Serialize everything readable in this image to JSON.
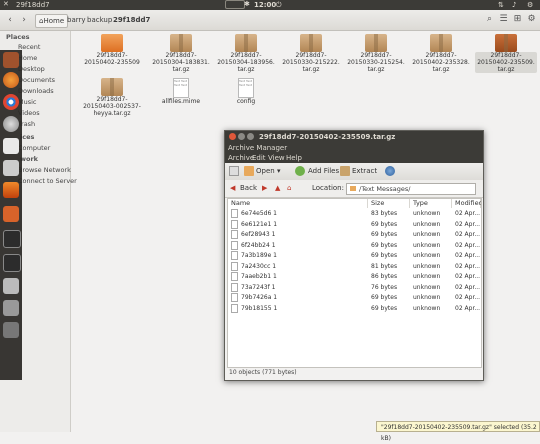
{
  "top_panel": {
    "title": "29f18dd7",
    "clock": "12:00"
  },
  "toolbar": {
    "breadcrumbs": [
      "Home",
      "barry",
      "backup",
      "29f18dd7"
    ]
  },
  "sidebar": {
    "places_header": "Places",
    "places": [
      "Recent",
      "Home",
      "Desktop",
      "Documents",
      "Downloads",
      "Music",
      "Videos",
      "Trash"
    ],
    "devices_header": "ices",
    "devices": [
      "Computer"
    ],
    "network_header": "work",
    "network": [
      "Browse Network",
      "Connect to Server"
    ]
  },
  "files": [
    {
      "label": [
        "29f18dd7-",
        "20150402-235509"
      ],
      "type": "folder"
    },
    {
      "label": [
        "29f18dd7-",
        "20150304-183831.",
        "tar.gz"
      ],
      "type": "archive"
    },
    {
      "label": [
        "29f18dd7-",
        "20150304-183956.",
        "tar.gz"
      ],
      "type": "archive"
    },
    {
      "label": [
        "29f18dd7-",
        "20150330-215222.",
        "tar.gz"
      ],
      "type": "archive"
    },
    {
      "label": [
        "29f18dd7-",
        "20150330-215254.",
        "tar.gz"
      ],
      "type": "archive"
    },
    {
      "label": [
        "29f18dd7-",
        "20150402-235328.",
        "tar.gz"
      ],
      "type": "archive"
    },
    {
      "label": [
        "29f18dd7-",
        "20150402-235509.",
        "tar.gz"
      ],
      "type": "archive-selected"
    },
    {
      "label": [
        "29f18dd7-",
        "20150403-002537-",
        "heyya.tar.gz"
      ],
      "type": "archive"
    },
    {
      "label": [
        "allfiles.mime"
      ],
      "type": "text"
    },
    {
      "label": [
        "config"
      ],
      "type": "text"
    }
  ],
  "archive_manager": {
    "window_title": "29f18dd7-20150402-235509.tar.gz",
    "app_name": "Archive Manager",
    "menu": [
      "Archive",
      "Edit",
      "View",
      "Help"
    ],
    "toolbar": {
      "open": "Open",
      "add_files": "Add Files",
      "extract": "Extract"
    },
    "nav": {
      "back": "Back",
      "location_label": "Location:",
      "location_value": "/Text Messages/"
    },
    "columns": [
      "Name",
      "Size",
      "Type",
      "Modified"
    ],
    "rows": [
      {
        "name": "6e74e5d6 1",
        "size": "83 bytes",
        "type": "unknown",
        "modified": "02 Apr..."
      },
      {
        "name": "6e6121e1 1",
        "size": "69 bytes",
        "type": "unknown",
        "modified": "02 Apr..."
      },
      {
        "name": "6ef28943 1",
        "size": "69 bytes",
        "type": "unknown",
        "modified": "02 Apr..."
      },
      {
        "name": "6f24bb24 1",
        "size": "69 bytes",
        "type": "unknown",
        "modified": "02 Apr..."
      },
      {
        "name": "7a3b189e 1",
        "size": "69 bytes",
        "type": "unknown",
        "modified": "02 Apr..."
      },
      {
        "name": "7a2430cc 1",
        "size": "81 bytes",
        "type": "unknown",
        "modified": "02 Apr..."
      },
      {
        "name": "7aaeb2b1 1",
        "size": "86 bytes",
        "type": "unknown",
        "modified": "02 Apr..."
      },
      {
        "name": "73a7243f 1",
        "size": "76 bytes",
        "type": "unknown",
        "modified": "02 Apr..."
      },
      {
        "name": "79b7426a 1",
        "size": "69 bytes",
        "type": "unknown",
        "modified": "02 Apr..."
      },
      {
        "name": "79b18155 1",
        "size": "69 bytes",
        "type": "unknown",
        "modified": "02 Apr..."
      }
    ],
    "status": "10 objects (771 bytes)"
  },
  "statusbar": {
    "text": "\"29f18dd7-20150402-235509.tar.gz\" selected  (35.2 kB)"
  }
}
